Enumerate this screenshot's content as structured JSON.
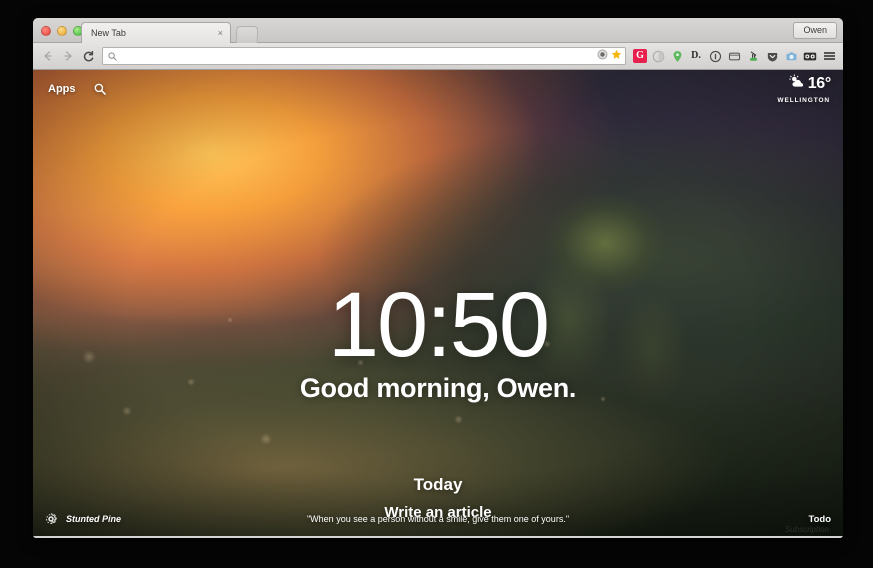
{
  "window": {
    "tab": {
      "title": "New Tab",
      "close_label": "×"
    },
    "new_tab_button_label": "",
    "profile_button_label": "Owen"
  },
  "toolbar": {
    "back_label": "Back",
    "forward_label": "Forward",
    "reload_label": "C",
    "omnibox": {
      "value": "",
      "placeholder": "",
      "search_icon": "search-icon",
      "page_action_icon": "page-action-icon",
      "bookmark_icon": "star-icon",
      "bookmark_color": "#f5b50a"
    },
    "extensions": [
      {
        "name": "grammarly",
        "label": "G",
        "color": "#e8204e"
      },
      {
        "name": "contrast-toggle",
        "label": "",
        "color": "#b9b7b5"
      },
      {
        "name": "location-pin",
        "label": "",
        "color": "#5cb85c"
      },
      {
        "name": "dashlane",
        "label": "D.",
        "color": "#2d2d2d"
      },
      {
        "name": "info-circle",
        "label": "",
        "color": "#4a4a4a"
      },
      {
        "name": "window-panel",
        "label": "",
        "color": "#5a5a5a"
      },
      {
        "name": "plug-socket",
        "label": "",
        "color": "#4caf50"
      },
      {
        "name": "pocket-shield",
        "label": "",
        "color": "#4a4a4a"
      },
      {
        "name": "camera-capture",
        "label": "",
        "color": "#7fb3d9"
      },
      {
        "name": "lastpass-vault",
        "label": "",
        "color": "#2e2e2e"
      }
    ],
    "menu_label": "Chrome menu"
  },
  "newtab": {
    "apps_label": "Apps",
    "search_icon": "search-icon",
    "weather": {
      "icon": "sun-behind-cloud-icon",
      "temperature": "16°",
      "city": "WELLINGTON"
    },
    "clock": "10:50",
    "greeting": "Good morning, Owen.",
    "today": {
      "heading": "Today",
      "task": "Write an article"
    },
    "footer": {
      "settings_icon": "gear-icon",
      "photo_title": "Stunted Pine",
      "quote": "\"When you see a person without a smile, give them one of yours.\"",
      "todo_label": "Todo",
      "watermark": "Subscription"
    }
  }
}
